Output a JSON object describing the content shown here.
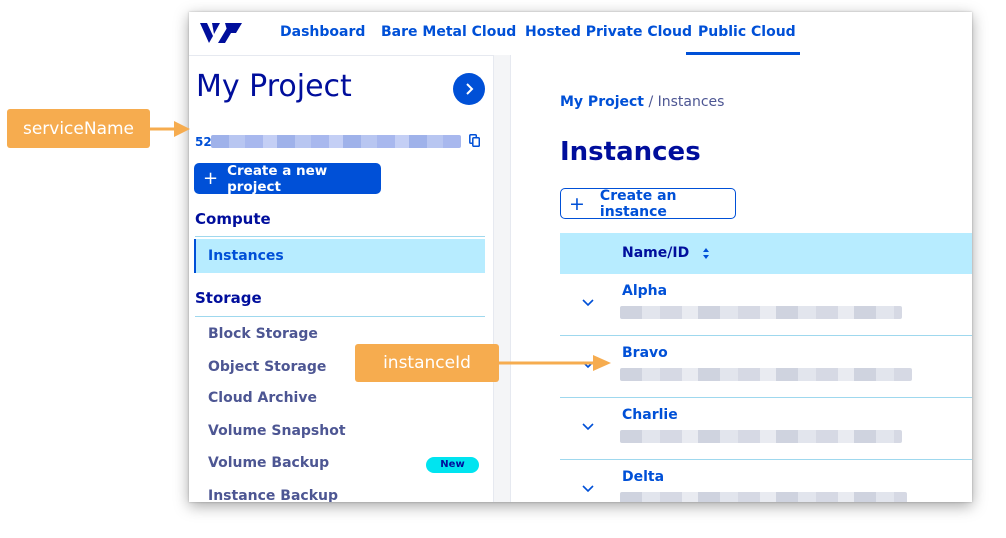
{
  "nav": {
    "items": [
      "Dashboard",
      "Bare Metal Cloud",
      "Hosted Private Cloud",
      "Public Cloud"
    ],
    "active": "Public Cloud"
  },
  "sidebar": {
    "project_title": "My Project",
    "service_prefix": "52",
    "create_project_label": "Create a new project",
    "sections": [
      {
        "title": "Compute",
        "items": [
          "Instances"
        ]
      },
      {
        "title": "Storage",
        "items": [
          "Block Storage",
          "Object Storage",
          "Cloud Archive",
          "Volume Snapshot",
          "Volume Backup",
          "Instance Backup"
        ]
      }
    ],
    "active_item": "Instances",
    "new_badge": "New"
  },
  "main": {
    "breadcrumb": {
      "link": "My Project",
      "separator": "/",
      "current": "Instances"
    },
    "title": "Instances",
    "create_instance_label": "Create an instance",
    "table": {
      "column_header": "Name/ID",
      "rows": [
        {
          "name": "Alpha"
        },
        {
          "name": "Bravo"
        },
        {
          "name": "Charlie"
        },
        {
          "name": "Delta"
        }
      ]
    }
  },
  "annotations": {
    "service_name": "serviceName",
    "instance_id": "instanceId"
  },
  "colors": {
    "brand_blue": "#0050d7",
    "navy": "#000e9c",
    "active_bg": "#b7ecff",
    "callout": "#f6ac4f",
    "badge": "#00e4f0"
  }
}
